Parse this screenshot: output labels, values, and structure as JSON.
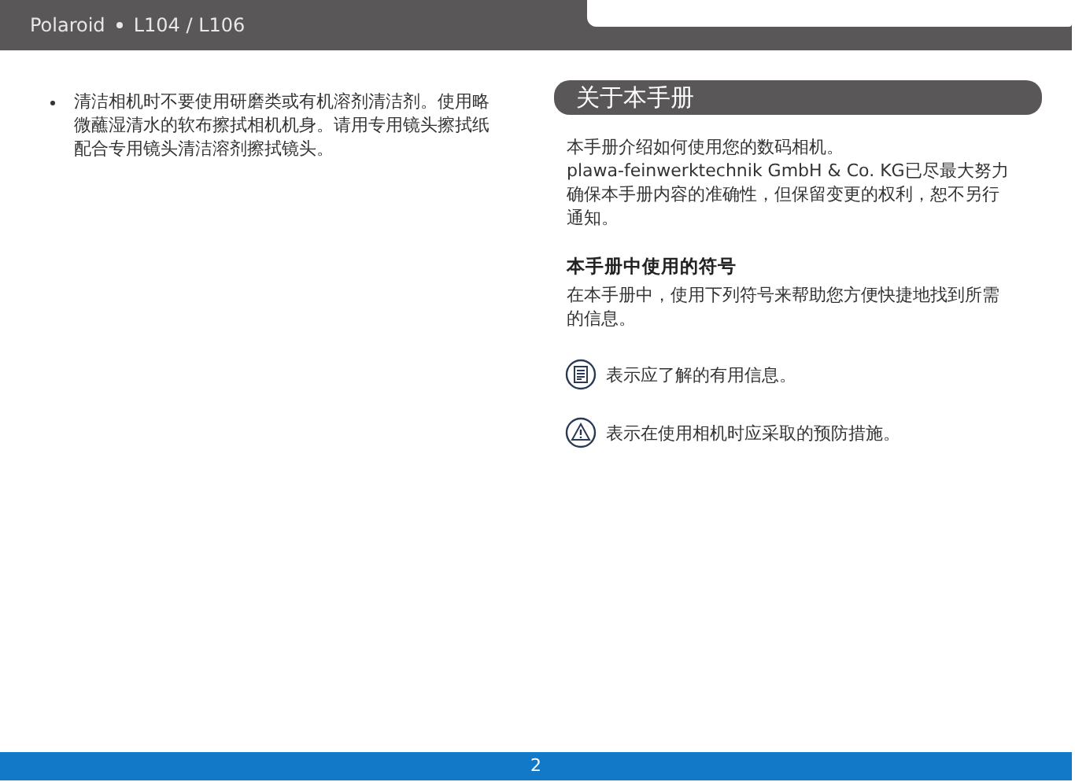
{
  "header": {
    "brand": "Polaroid",
    "model": "L104 / L106"
  },
  "left": {
    "bullets": [
      "清洁相机时不要使用研磨类或有机溶剂清洁剂。使用略微蘸湿清水的软布擦拭相机机身。请用专用镜头擦拭纸配合专用镜头清洁溶剂擦拭镜头。"
    ]
  },
  "right": {
    "section_title": "关于本手册",
    "intro": [
      "本手册介绍如何使用您的数码相机。",
      "plawa-feinwerktechnik GmbH & Co. KG已尽最大努力确保本手册内容的准确性，但保留变更的权利，恕不另行通知。"
    ],
    "subheading": "本手册中使用的符号",
    "subtext": "在本手册中，使用下列符号来帮助您方便快捷地找到所需的信息。",
    "symbols": [
      {
        "kind": "note",
        "text": "表示应了解的有用信息。"
      },
      {
        "kind": "warning",
        "text": "表示在使用相机时应采取的预防措施。"
      }
    ]
  },
  "footer": {
    "page": "2"
  }
}
